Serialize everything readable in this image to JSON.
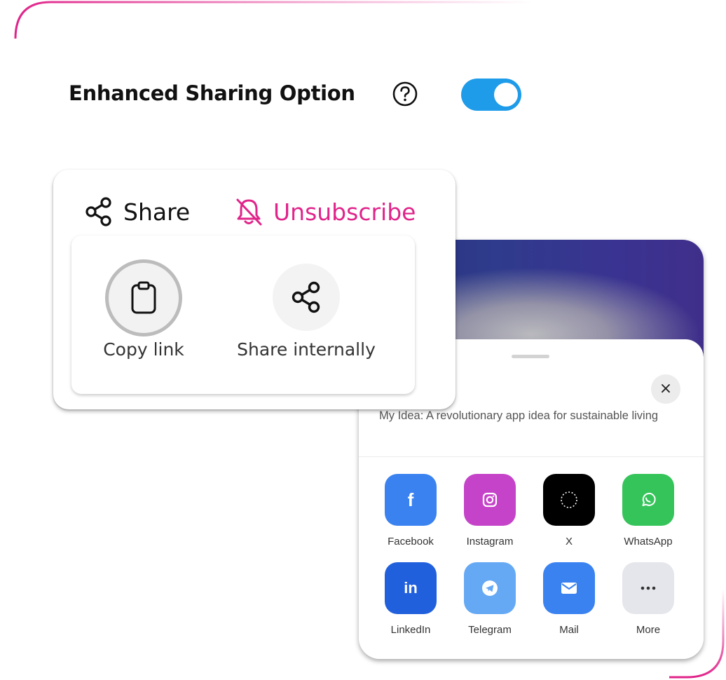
{
  "option": {
    "title": "Enhanced Sharing Option",
    "help_icon": "question-circle-icon",
    "enabled": true,
    "toggle_color": "#1e9be9"
  },
  "share_card": {
    "tabs": {
      "share": {
        "label": "Share",
        "icon": "share-icon"
      },
      "unsubscribe": {
        "label": "Unsubscribe",
        "icon": "bell-off-icon",
        "color": "#e0248a"
      }
    },
    "actions": [
      {
        "label": "Copy link",
        "icon": "clipboard-icon"
      },
      {
        "label": "Share internally",
        "icon": "share-icon"
      }
    ]
  },
  "share_sheet": {
    "close_label": "×",
    "description": "My Idea: A revolutionary app idea for sustainable living",
    "apps": [
      {
        "label": "Facebook",
        "icon": "facebook-icon",
        "color": "#3a82f0",
        "glyph": "f"
      },
      {
        "label": "Instagram",
        "icon": "instagram-icon",
        "color": "#c543c8"
      },
      {
        "label": "X",
        "icon": "x-icon",
        "color": "#000000"
      },
      {
        "label": "WhatsApp",
        "icon": "whatsapp-icon",
        "color": "#35c45a"
      },
      {
        "label": "LinkedIn",
        "icon": "linkedin-icon",
        "color": "#2160dc",
        "glyph": "in"
      },
      {
        "label": "Telegram",
        "icon": "telegram-icon",
        "color": "#65a9f4"
      },
      {
        "label": "Mail",
        "icon": "mail-icon",
        "color": "#3a82f0"
      },
      {
        "label": "More",
        "icon": "more-icon",
        "color": "#e5e6eb"
      }
    ]
  }
}
